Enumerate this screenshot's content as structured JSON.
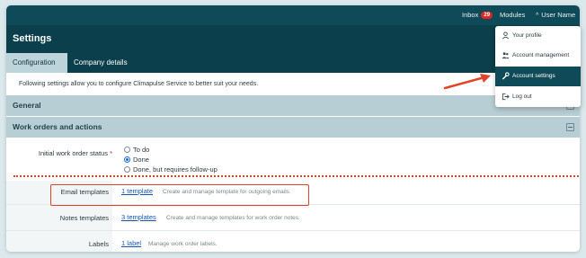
{
  "topbar": {
    "inbox_label": "Inbox",
    "inbox_count": "29",
    "modules_label": "Modules",
    "user_label": "User Name"
  },
  "header": {
    "title": "Settings",
    "tabs": [
      {
        "label": "Configuration",
        "active": true
      },
      {
        "label": "Company details",
        "active": false
      }
    ]
  },
  "intro_text": "Following settings allow you to configure Climapulse Service to better suit your needs.",
  "sections": {
    "general": "General",
    "work_orders": "Work orders and actions"
  },
  "initial_status": {
    "label": "Initial work order status",
    "required_mark": "*",
    "options": [
      {
        "label": "To do",
        "checked": false
      },
      {
        "label": "Done",
        "checked": true
      },
      {
        "label": "Done, but requires follow-up",
        "checked": false
      }
    ]
  },
  "template_rows": [
    {
      "label": "Email templates",
      "link": "1 template",
      "description": "Create and manage template for outgoing emails."
    },
    {
      "label": "Notes templates",
      "link": "3 templates",
      "description": "Create and manage templates for work order notes."
    },
    {
      "label": "Labels",
      "link": "1 label",
      "description": "Manage work order labels."
    }
  ],
  "user_menu": {
    "items": [
      {
        "label": "Your profile",
        "icon": "user-icon"
      },
      {
        "label": "Account management",
        "icon": "users-icon"
      },
      {
        "label": "Account settings",
        "icon": "wrench-icon",
        "active": true
      },
      {
        "label": "Log out",
        "icon": "logout-icon"
      }
    ]
  },
  "colors": {
    "header": "#0a3f4b",
    "topbar": "#0e4a57",
    "section": "#b7ced4",
    "annotation": "#e0452a",
    "link": "#1456b8"
  }
}
